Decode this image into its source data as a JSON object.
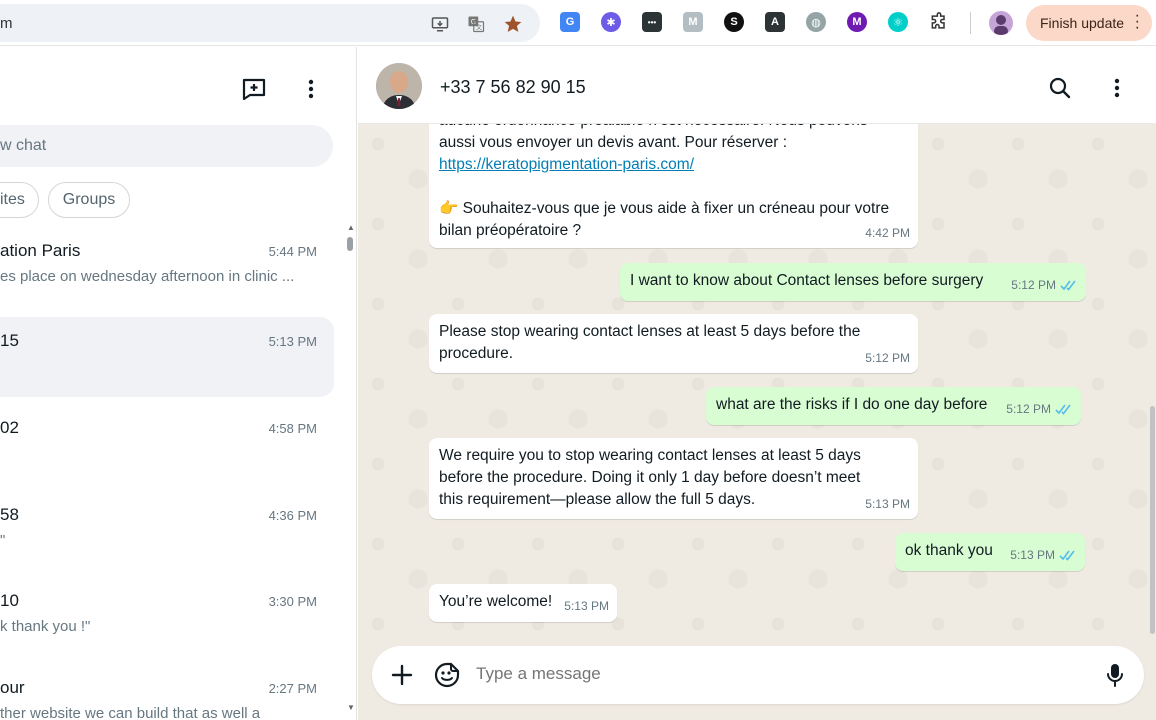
{
  "browser": {
    "url_fragment": "m",
    "finish_update_label": "Finish update",
    "extensions": [
      {
        "icon": "google-translate-icon",
        "color": "#4285f4",
        "glyph": "G"
      },
      {
        "icon": "snowflake-icon",
        "color": "#6c5ce7",
        "glyph": "✱"
      },
      {
        "icon": "dots-box-icon",
        "color": "#2d3436",
        "glyph": "•••"
      },
      {
        "icon": "m-letter-icon",
        "color": "#b2bec3",
        "glyph": "M"
      },
      {
        "icon": "s-letter-icon",
        "color": "#111111",
        "glyph": "S"
      },
      {
        "icon": "a-triangle-icon",
        "color": "#2d3436",
        "glyph": "A"
      },
      {
        "icon": "globe-icon",
        "color": "#95a5a6",
        "glyph": "◍"
      },
      {
        "icon": "m-purple-icon",
        "color": "#6f1ab1",
        "glyph": "M"
      },
      {
        "icon": "atom-icon",
        "color": "#00cec9",
        "glyph": "⚛"
      }
    ]
  },
  "sidebar": {
    "search_placeholder": "w chat",
    "filters": [
      "ites",
      "Groups"
    ],
    "chats": [
      {
        "name": "ation Paris",
        "time": "5:44 PM",
        "preview": "es place on wednesday afternoon in clinic ..."
      },
      {
        "name": "15",
        "time": "5:13 PM",
        "preview": ""
      },
      {
        "name": "02",
        "time": "4:58 PM",
        "preview": ""
      },
      {
        "name": "58",
        "time": "4:36 PM",
        "preview": "\""
      },
      {
        "name": "10",
        "time": "3:30 PM",
        "preview": "k thank you !\""
      },
      {
        "name": "our",
        "time": "2:27 PM",
        "preview": "ther website we can build that as well a"
      }
    ]
  },
  "chat": {
    "contact_name": "+33 7 56 82 90 15",
    "messages": [
      {
        "dir": "in",
        "text_1": "aucune ordonnance préalable n'est nécessaire. Nous pouvons\naussi vous envoyer un devis avant. Pour réserver :",
        "link": "https://keratopigmentation-paris.com/",
        "text_2": "👉 Souhaitez-vous que je vous aide à fixer un créneau pour votre\nbilan préopératoire ?",
        "time": "4:42 PM"
      },
      {
        "dir": "out",
        "text": "I want to know about Contact lenses before surgery",
        "time": "5:12 PM"
      },
      {
        "dir": "in",
        "text": "Please stop wearing contact lenses at least 5 days before the\nprocedure.",
        "time": "5:12 PM"
      },
      {
        "dir": "out",
        "text": "what are the risks if I do one day before",
        "time": "5:12 PM"
      },
      {
        "dir": "in",
        "text": "We require you to stop wearing contact lenses at least 5 days\nbefore the procedure. Doing it only 1 day before doesn’t meet\nthis requirement—please allow the full 5 days.",
        "time": "5:13 PM"
      },
      {
        "dir": "out",
        "text": "ok thank you",
        "time": "5:13 PM"
      },
      {
        "dir": "in",
        "text": "You’re welcome!",
        "time": "5:13 PM"
      }
    ],
    "composer_placeholder": "Type a message"
  },
  "colors": {
    "incoming_bubble": "#ffffff",
    "outgoing_bubble": "#d9fdd3",
    "read_ticks": "#53bdeb",
    "wallpaper": "#efeae2"
  }
}
